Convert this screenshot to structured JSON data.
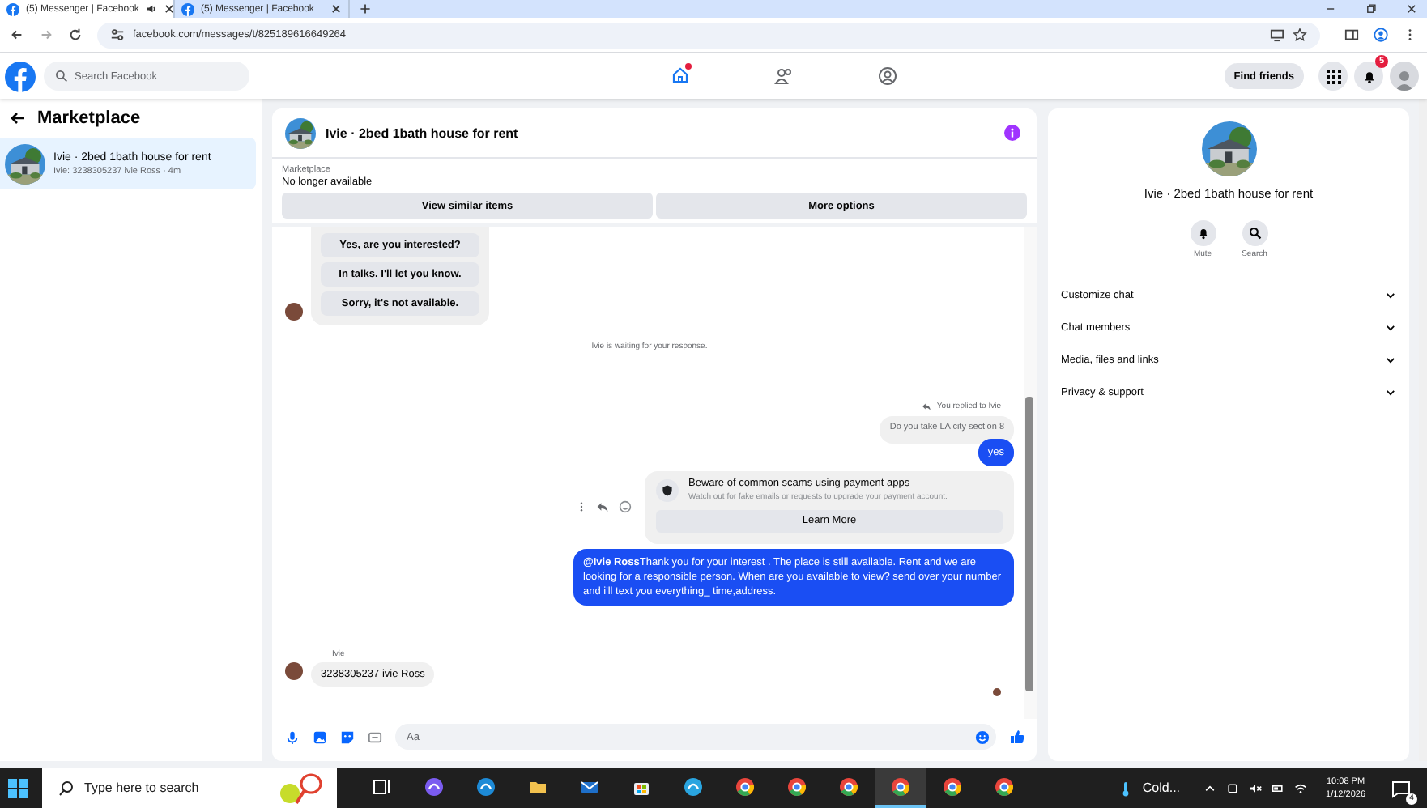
{
  "browser": {
    "tabs": [
      {
        "title": "(5) Messenger | Facebook",
        "selected": true,
        "muted_icon": true
      },
      {
        "title": "(5) Messenger | Facebook",
        "selected": false,
        "muted_icon": false
      }
    ],
    "url": "facebook.com/messages/t/825189616649264"
  },
  "header": {
    "search": {
      "placeholder": "Search Facebook"
    },
    "nav": [
      {
        "kind": "home",
        "selected": true,
        "dot": true
      },
      {
        "kind": "friends",
        "selected": false,
        "dot": false
      },
      {
        "kind": "groups",
        "selected": false,
        "dot": false
      }
    ],
    "find_friends": "Find friends",
    "notification_count": "5"
  },
  "sidebar": {
    "title": "Marketplace",
    "conversations": [
      {
        "title": "Ivie · 2bed 1bath house for rent",
        "preview": "Ivie: 3238305237 ivie Ross · 4m",
        "selected": true
      }
    ]
  },
  "chat": {
    "title": "Ivie · 2bed 1bath house for rent",
    "banner": {
      "label": "Marketplace",
      "status": "No longer available"
    },
    "actions": [
      "View similar items",
      "More options"
    ],
    "messages": [
      {
        "kind": "quick_replies",
        "options": [
          "Yes, are you interested?",
          "In talks. I'll let you know.",
          "Sorry, it's not available."
        ]
      },
      {
        "kind": "system",
        "text": "Ivie is waiting for your response."
      },
      {
        "kind": "reply_note",
        "text": "You replied to Ivie"
      },
      {
        "kind": "quoted",
        "text": "Do you take LA city section 8"
      },
      {
        "kind": "outgoing",
        "text": "yes"
      },
      {
        "kind": "scam_notice",
        "title": "Beware of common scams using payment apps",
        "body": "Watch out for fake emails or requests to upgrade your payment account.",
        "button": "Learn More"
      },
      {
        "kind": "outgoing",
        "text": "**@Ivie Ross**Thank you for your interest . The place is still available. Rent and we are looking for a responsible person. When are you available to view? send over your number and i'll text you everything_ time,address."
      },
      {
        "kind": "incoming",
        "sender": "Ivie",
        "text": "3238305237 ivie Ross"
      },
      {
        "kind": "seen"
      }
    ],
    "composer": {
      "placeholder": "Aa"
    }
  },
  "details": {
    "title": "Ivie · 2bed 1bath house for rent",
    "actions": [
      {
        "kind": "mute",
        "label": "Mute"
      },
      {
        "kind": "search",
        "label": "Search"
      }
    ],
    "sections": [
      {
        "label": "Customize chat",
        "expanded": false
      },
      {
        "label": "Chat members",
        "expanded": false
      },
      {
        "label": "Media, files and links",
        "expanded": false
      },
      {
        "label": "Privacy & support",
        "expanded": false
      }
    ]
  },
  "taskbar": {
    "search": {
      "placeholder": "Type here to search"
    },
    "apps": [
      {
        "kind": "taskview",
        "selected": false
      },
      {
        "kind": "copilot",
        "selected": false
      },
      {
        "kind": "edge",
        "selected": false
      },
      {
        "kind": "folder",
        "selected": false
      },
      {
        "kind": "mail",
        "selected": false
      },
      {
        "kind": "store",
        "selected": false
      },
      {
        "kind": "shield",
        "selected": false
      },
      {
        "kind": "chrome",
        "selected": false
      },
      {
        "kind": "chrome",
        "selected": false
      },
      {
        "kind": "chrome",
        "selected": false
      },
      {
        "kind": "chrome",
        "selected": true
      },
      {
        "kind": "chrome",
        "selected": false
      },
      {
        "kind": "chrome",
        "selected": false
      }
    ],
    "weather": "Cold...",
    "time": "10:08 PM",
    "date": "1/12/2026",
    "notification_count": "4"
  }
}
